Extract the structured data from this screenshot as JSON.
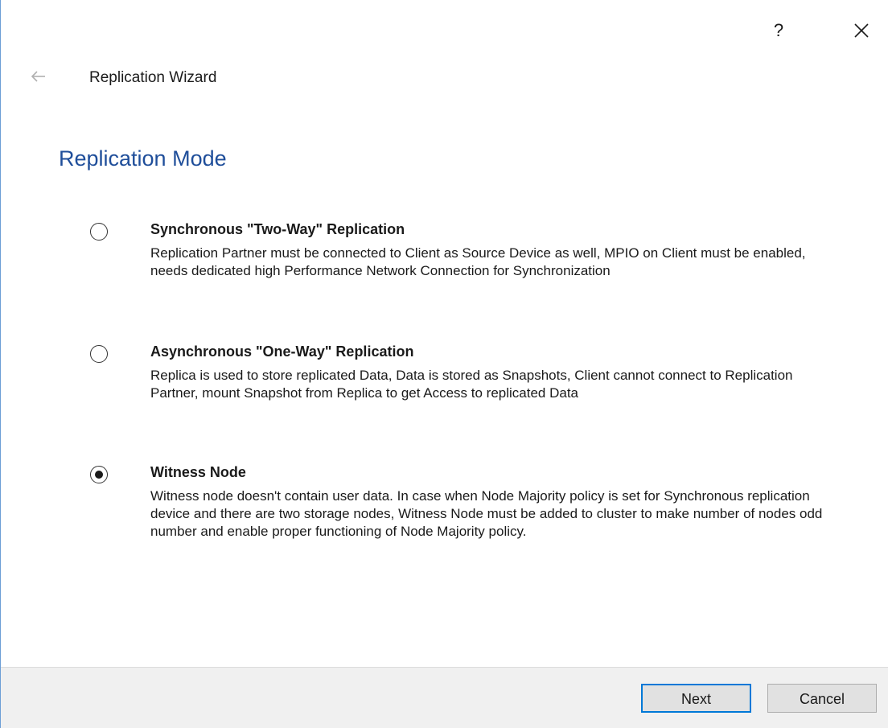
{
  "titlebar": {
    "help_label": "?",
    "close_icon": "close-icon"
  },
  "header": {
    "back_icon": "back-arrow-icon",
    "wizard_title": "Replication Wizard"
  },
  "page": {
    "heading": "Replication Mode"
  },
  "options": [
    {
      "title": "Synchronous \"Two-Way\" Replication",
      "description": "Replication Partner must be connected to Client as Source Device as well, MPIO on Client must be enabled, needs dedicated high Performance Network Connection for Synchronization",
      "selected": false
    },
    {
      "title": "Asynchronous \"One-Way\" Replication",
      "description": "Replica is used to store replicated Data, Data is stored as Snapshots, Client cannot connect to Replication Partner, mount Snapshot from Replica to get Access to replicated Data",
      "selected": false
    },
    {
      "title": "Witness Node",
      "description": "Witness node doesn't contain user data. In case when Node Majority policy is set for Synchronous replication device and there are two storage nodes, Witness Node must be added to cluster to make number of nodes odd number and enable proper functioning of Node Majority policy.",
      "selected": true
    }
  ],
  "footer": {
    "next_label": "Next",
    "cancel_label": "Cancel"
  },
  "colors": {
    "heading": "#1f4e9a",
    "primary_border": "#0078d7",
    "footer_bg": "#f0f0f0",
    "window_border": "#6d9fd6"
  }
}
